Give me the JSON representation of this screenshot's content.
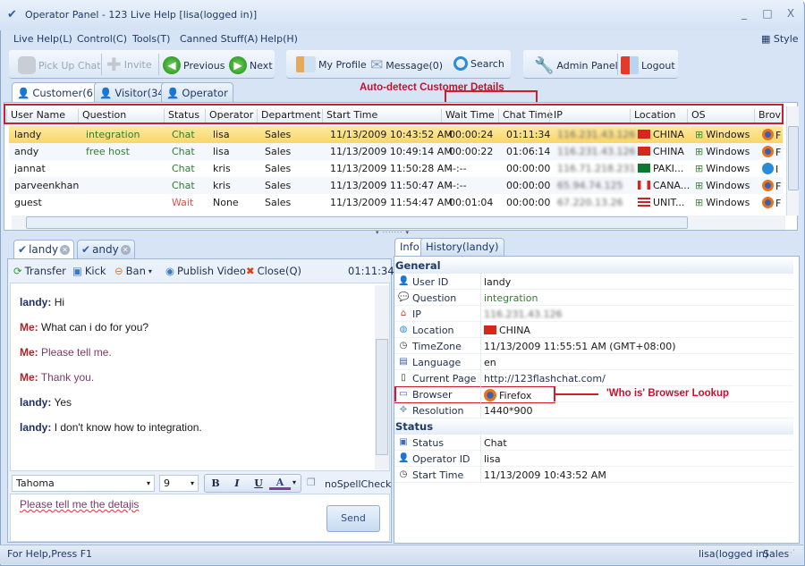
{
  "window": {
    "title": "Operator Panel - 123 Live Help [lisa(logged in)]",
    "minimize": "_",
    "maximize": "□",
    "close": "X"
  },
  "menu": [
    "Live Help(L)",
    "Control(C)",
    "Tools(T)",
    "Canned Stuff(A)",
    "Help(H)"
  ],
  "style_label": "Style",
  "toolbar": {
    "pick_up_chat": "Pick Up Chat",
    "invite": "Invite",
    "previous": "Previous",
    "next": "Next",
    "my_profile": "My Profile",
    "message": "Message(0)",
    "search": "Search",
    "admin_panel": "Admin Panel",
    "logout": "Logout"
  },
  "list_tabs": [
    "Customer(6)",
    "Visitor(34)",
    "Operator"
  ],
  "annotations": {
    "customer": "Auto-detect Customer Details",
    "browser": "'Who is' Browser Lookup"
  },
  "grid": {
    "columns": [
      "User Name",
      "Question",
      "Status",
      "Operator",
      "Department",
      "Start Time",
      "Wait Time",
      "Chat Time",
      "IP",
      "Location",
      "OS",
      "Brov"
    ],
    "rows": [
      {
        "user": "landy",
        "question": "integration",
        "status": "Chat",
        "operator": "lisa",
        "department": "Sales",
        "start": "11/13/2009 10:43:52 AM",
        "wait": "00:00:24",
        "chat": "01:11:34",
        "ip": "116.231.43.126",
        "location": "CHINA",
        "os": "Windows",
        "browser": "F",
        "browser_icon": "firefox"
      },
      {
        "user": "andy",
        "question": "free host",
        "status": "Chat",
        "operator": "lisa",
        "department": "Sales",
        "start": "11/13/2009 10:49:14 AM",
        "wait": "00:00:22",
        "chat": "01:06:14",
        "ip": "116.231.43.126",
        "location": "CHINA",
        "os": "Windows",
        "browser": "F",
        "browser_icon": "firefox"
      },
      {
        "user": "jannat",
        "question": "",
        "status": "Chat",
        "operator": "kris",
        "department": "Sales",
        "start": "11/13/2009 11:50:28 AM",
        "wait": "--:--",
        "chat": "00:00:00",
        "ip": "116.71.218.231",
        "location": "PAKI...",
        "os": "Windows",
        "browser": "I",
        "browser_icon": "ie"
      },
      {
        "user": "parveenkhan",
        "question": "",
        "status": "Chat",
        "operator": "kris",
        "department": "Sales",
        "start": "11/13/2009 11:50:47 AM",
        "wait": "--:--",
        "chat": "00:00:00",
        "ip": "65.94.74.125",
        "location": "CANA...",
        "os": "Windows",
        "browser": "F",
        "browser_icon": "firefox"
      },
      {
        "user": "guest",
        "question": "",
        "status": "Wait",
        "operator": "None",
        "department": "Sales",
        "start": "11/13/2009 11:54:47 AM",
        "wait": "00:01:04",
        "chat": "00:00:00",
        "ip": "67.220.13.26",
        "location": "UNIT...",
        "os": "Windows",
        "browser": "F",
        "browser_icon": "firefox"
      }
    ]
  },
  "chat_tabs": [
    "landy",
    "andy"
  ],
  "chat_toolbar": {
    "transfer": "Transfer",
    "kick": "Kick",
    "ban": "Ban",
    "publish_video": "Publish Video",
    "close": "Close(Q)",
    "timer": "01:11:34"
  },
  "messages": [
    {
      "from": "landy:",
      "text": "Hi",
      "type": "customer"
    },
    {
      "from": "Me:",
      "text": "What can i do for you?",
      "type": "me"
    },
    {
      "from": "Me:",
      "text": "Please tell me.",
      "type": "me2"
    },
    {
      "from": "Me:",
      "text": "Thank you.",
      "type": "me2"
    },
    {
      "from": "landy:",
      "text": "Yes",
      "type": "customer"
    },
    {
      "from": "landy:",
      "text": "I don't know how to integration.",
      "type": "customer"
    }
  ],
  "format_bar": {
    "font": "Tahoma",
    "size": "9",
    "bold": "B",
    "italic": "I",
    "underline": "U",
    "color": "A",
    "spellcheck": "noSpellCheck"
  },
  "input": {
    "value": "Please tell me the detajis",
    "send": "Send"
  },
  "info_tabs": [
    "Info",
    "History(landy)"
  ],
  "info": {
    "general_title": "General",
    "general": [
      {
        "label": "User ID",
        "value": "landy",
        "icon": "user"
      },
      {
        "label": "Question",
        "value": "integration",
        "icon": "speech"
      },
      {
        "label": "IP",
        "value": "116.231.43.126",
        "icon": "home"
      },
      {
        "label": "Location",
        "value": "CHINA",
        "icon": "globe"
      },
      {
        "label": "TimeZone",
        "value": "11/13/2009 11:55:51 AM (GMT+08:00)",
        "icon": "clock"
      },
      {
        "label": "Language",
        "value": "en",
        "icon": "language"
      },
      {
        "label": "Current Page",
        "value": "http://123flashchat.com/",
        "icon": "page"
      },
      {
        "label": "Browser",
        "value": "Firefox",
        "icon": "monitor"
      },
      {
        "label": "Resolution",
        "value": "1440*900",
        "icon": "resize"
      }
    ],
    "status_title": "Status",
    "status": [
      {
        "label": "Status",
        "value": "Chat",
        "icon": "status"
      },
      {
        "label": "Operator ID",
        "value": "lisa",
        "icon": "operator"
      },
      {
        "label": "Start Time",
        "value": "11/13/2009 10:43:52 AM",
        "icon": "clock"
      }
    ]
  },
  "statusbar": {
    "help": "For Help,Press F1",
    "user": "lisa(logged in)",
    "dept": "Sales"
  },
  "colors": {
    "chat_status": "#2e7d32",
    "wait_status": "#d9534f",
    "selected_row": "#f8d66a",
    "annotation": "#c8102e"
  }
}
